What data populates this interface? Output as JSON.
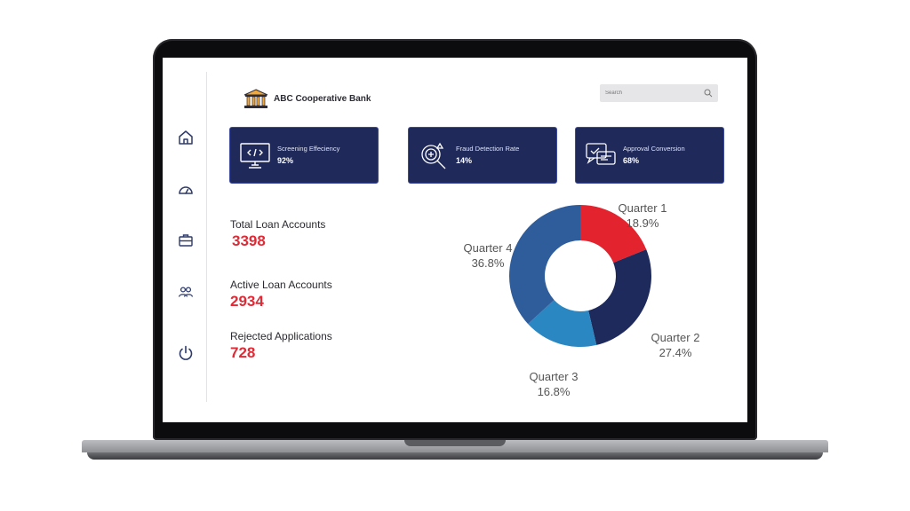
{
  "brand": {
    "name": "ABC Cooperative Bank",
    "logo_icon": "bank-building-icon"
  },
  "search": {
    "placeholder": "Search"
  },
  "sidebar": {
    "items": [
      {
        "id": "home",
        "icon": "home-icon"
      },
      {
        "id": "dashboard",
        "icon": "gauge-icon"
      },
      {
        "id": "portfolio",
        "icon": "briefcase-icon"
      },
      {
        "id": "users",
        "icon": "users-icon"
      },
      {
        "id": "logout",
        "icon": "power-icon"
      }
    ]
  },
  "kpis": [
    {
      "title": "Screening Effeciency",
      "value": "92%",
      "icon": "monitor-code-icon"
    },
    {
      "title": "Fraud Detection Rate",
      "value": "14%",
      "icon": "fraud-search-icon"
    },
    {
      "title": "Approval Conversion",
      "value": "68%",
      "icon": "approval-chat-icon"
    }
  ],
  "stats": [
    {
      "label": "Total Loan Accounts",
      "value": "3398"
    },
    {
      "label": "Active Loan Accounts",
      "value": "2934"
    },
    {
      "label": "Rejected Applications",
      "value": "728"
    }
  ],
  "colors": {
    "card_bg": "#1f2a5a",
    "accent_red": "#e02a36"
  },
  "chart_data": {
    "type": "pie",
    "donut": true,
    "categories": [
      "Quarter 1",
      "Quarter 2",
      "Quarter 3",
      "Quarter 4"
    ],
    "values": [
      18.9,
      27.4,
      16.8,
      36.8
    ],
    "value_labels": [
      "18.9%",
      "27.4%",
      "16.8%",
      "36.8%"
    ],
    "colors": [
      "#e3232e",
      "#1e2a5c",
      "#2b87c2",
      "#2f5d9c"
    ]
  }
}
